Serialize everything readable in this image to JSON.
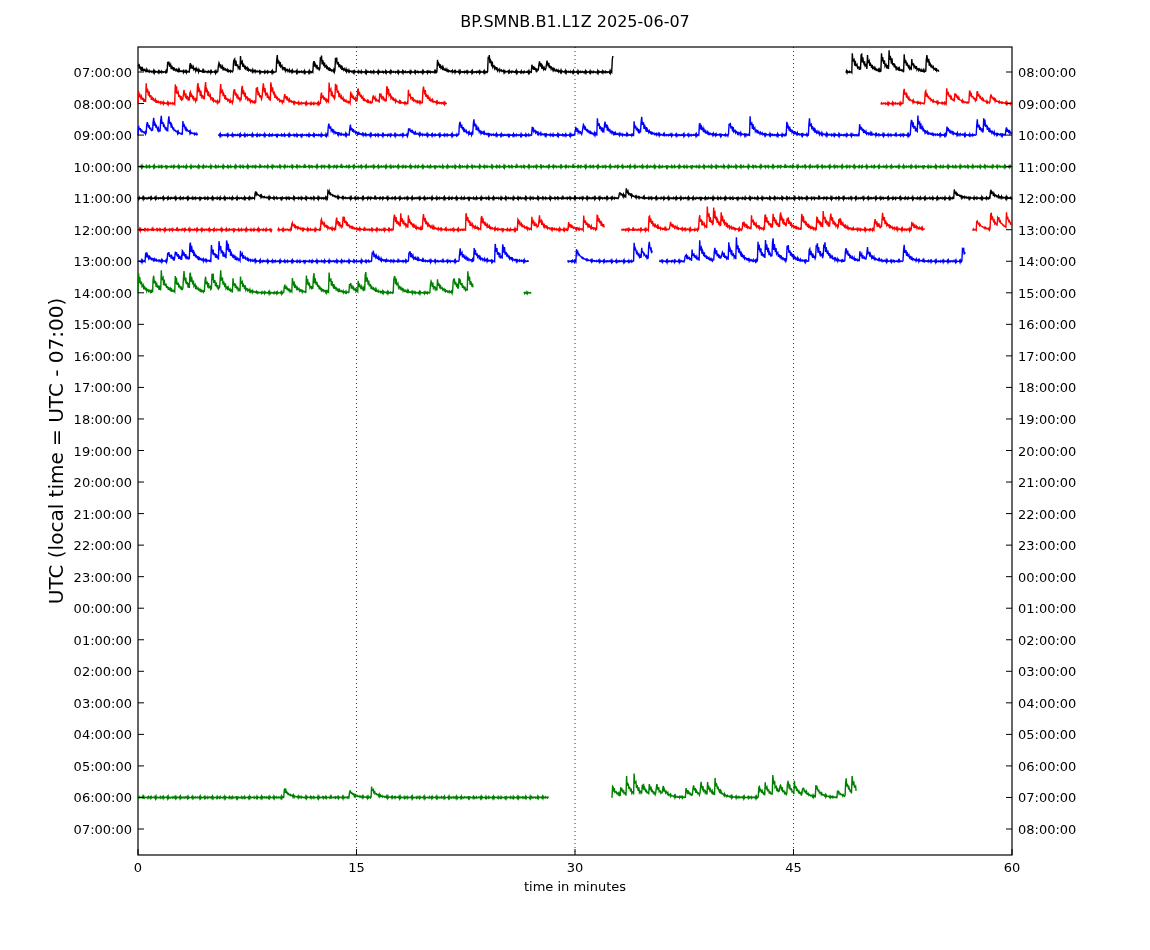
{
  "title": "BP.SMNB.B1.L1Z 2025-06-07",
  "ylabel": "UTC (local time = UTC - 07:00)",
  "xlabel": "time in minutes",
  "left_ticks": [
    "07:00:00",
    "08:00:00",
    "09:00:00",
    "10:00:00",
    "11:00:00",
    "12:00:00",
    "13:00:00",
    "14:00:00",
    "15:00:00",
    "16:00:00",
    "17:00:00",
    "18:00:00",
    "19:00:00",
    "20:00:00",
    "21:00:00",
    "22:00:00",
    "23:00:00",
    "00:00:00",
    "01:00:00",
    "02:00:00",
    "03:00:00",
    "04:00:00",
    "05:00:00",
    "06:00:00",
    "07:00:00"
  ],
  "right_ticks": [
    "08:00:00",
    "09:00:00",
    "10:00:00",
    "11:00:00",
    "12:00:00",
    "13:00:00",
    "14:00:00",
    "15:00:00",
    "16:00:00",
    "17:00:00",
    "18:00:00",
    "19:00:00",
    "20:00:00",
    "21:00:00",
    "22:00:00",
    "23:00:00",
    "00:00:00",
    "01:00:00",
    "02:00:00",
    "03:00:00",
    "04:00:00",
    "05:00:00",
    "06:00:00",
    "07:00:00",
    "08:00:00"
  ],
  "x_ticks": [
    "0",
    "15",
    "30",
    "45",
    "60"
  ]
}
